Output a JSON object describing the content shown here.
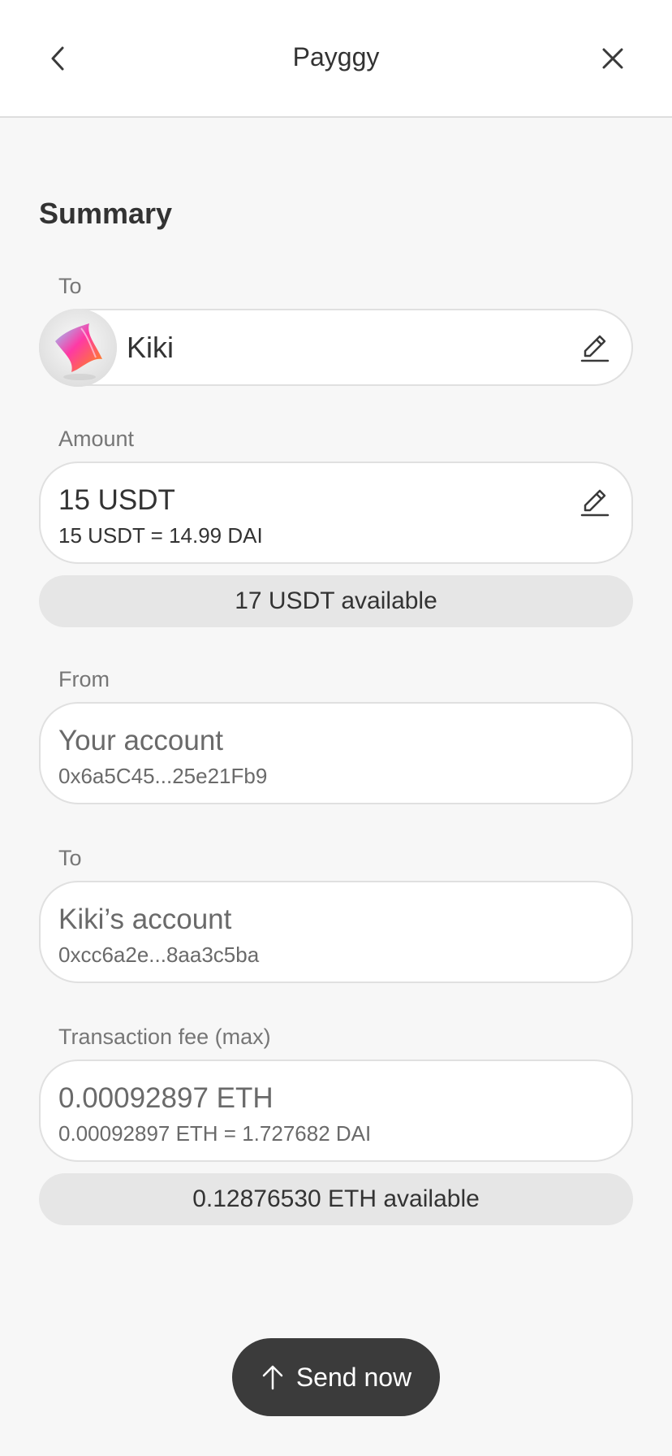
{
  "header": {
    "title": "Payggy",
    "back_icon": "chevron-left-icon",
    "close_icon": "close-icon"
  },
  "summary": {
    "title": "Summary",
    "recipient": {
      "label": "To",
      "name": "Kiki",
      "edit_icon": "pencil-icon"
    },
    "amount": {
      "label": "Amount",
      "value": "15 USDT",
      "conversion": "15 USDT = 14.99 DAI",
      "available": "17 USDT available",
      "edit_icon": "pencil-icon"
    },
    "from": {
      "label": "From",
      "account": "Your account",
      "address": "0x6a5C45...25e21Fb9"
    },
    "to_account": {
      "label": "To",
      "account": "Kiki’s account",
      "address": "0xcc6a2e...8aa3c5ba"
    },
    "fee": {
      "label": "Transaction fee (max)",
      "value": "0.00092897 ETH",
      "conversion": "0.00092897 ETH = 1.727682 DAI",
      "available": "0.12876530 ETH available"
    }
  },
  "send_button": {
    "label": "Send now",
    "icon": "arrow-up-icon"
  },
  "colors": {
    "background": "#f7f7f7",
    "card": "#ffffff",
    "pill": "#e6e6e6",
    "button": "#3b3b3b"
  }
}
